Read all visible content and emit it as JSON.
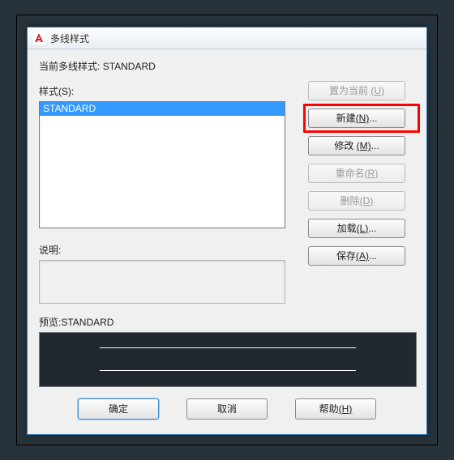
{
  "titlebar": {
    "title": "多线样式"
  },
  "current_style": {
    "label_prefix": "当前多线样式:",
    "value": "STANDARD"
  },
  "styles": {
    "label": "样式(S):",
    "items": [
      "STANDARD"
    ],
    "selected_index": 0
  },
  "description": {
    "label": "说明:",
    "value": ""
  },
  "preview": {
    "label_prefix": "预览:",
    "value": "STANDARD"
  },
  "side_buttons": {
    "set_current": {
      "text": "置为当前 ",
      "mnemonic": "(U)",
      "enabled": false
    },
    "new_btn": {
      "text": "新建",
      "mnemonic": "(N)",
      "suffix": "...",
      "enabled": true
    },
    "modify": {
      "text": "修改 ",
      "mnemonic": "(M)",
      "suffix": "...",
      "enabled": true
    },
    "rename": {
      "text": "重命名",
      "mnemonic": "(R)",
      "enabled": false
    },
    "delete_btn": {
      "text": "删除",
      "mnemonic": "(D)",
      "enabled": false
    },
    "load": {
      "text": "加载",
      "mnemonic": "(L)",
      "suffix": "...",
      "enabled": true
    },
    "save": {
      "text": "保存",
      "mnemonic": "(A)",
      "suffix": "...",
      "enabled": true
    }
  },
  "bottom_buttons": {
    "ok": {
      "text": "确定"
    },
    "cancel": {
      "text": "取消"
    },
    "help": {
      "text": "帮助",
      "mnemonic": "(H)"
    }
  }
}
